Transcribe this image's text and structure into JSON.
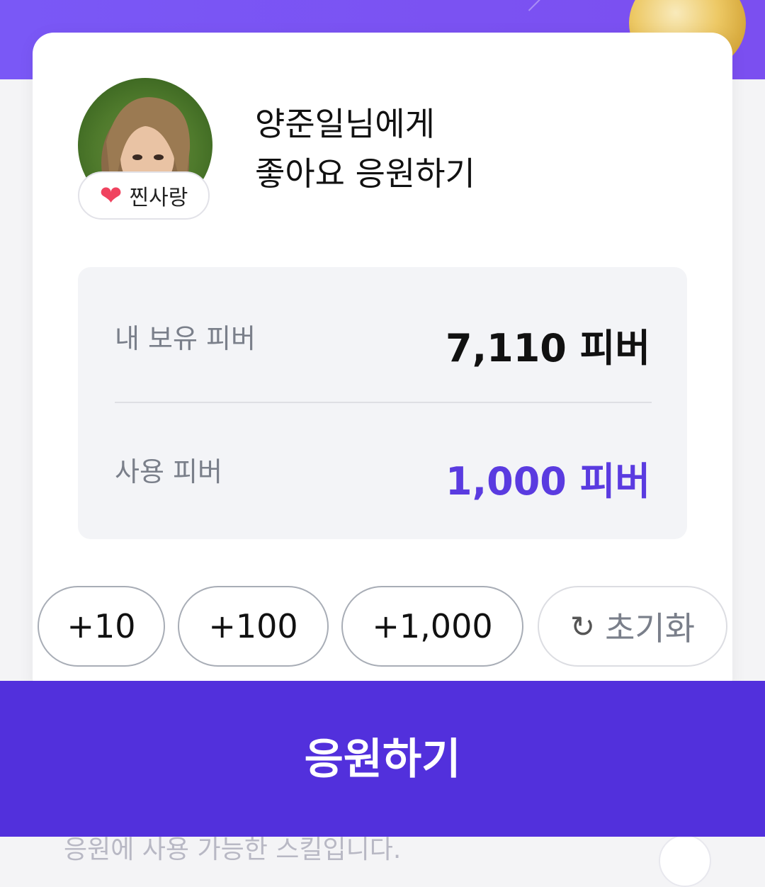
{
  "modal": {
    "title_line1": "양준일님에게",
    "title_line2": "좋아요 응원하기",
    "badge_label": "찐사랑",
    "badge_icon": "heart-icon"
  },
  "balance": {
    "owned_label": "내 보유 피버",
    "owned_value": "7,110 피버",
    "use_label": "사용 피버",
    "use_value": "1,000 피버"
  },
  "quick_amounts": [
    {
      "label": "+10"
    },
    {
      "label": "+100"
    },
    {
      "label": "+1,000"
    }
  ],
  "reset": {
    "label": "초기화",
    "icon": "reset-icon"
  },
  "cta": {
    "label": "응원하기"
  },
  "background": {
    "footer_text": "응원에 사용 가능한 스킬입니다."
  },
  "colors": {
    "accent": "#5230dc",
    "use_value": "#5a3be0",
    "banner": "#7a58f6"
  }
}
